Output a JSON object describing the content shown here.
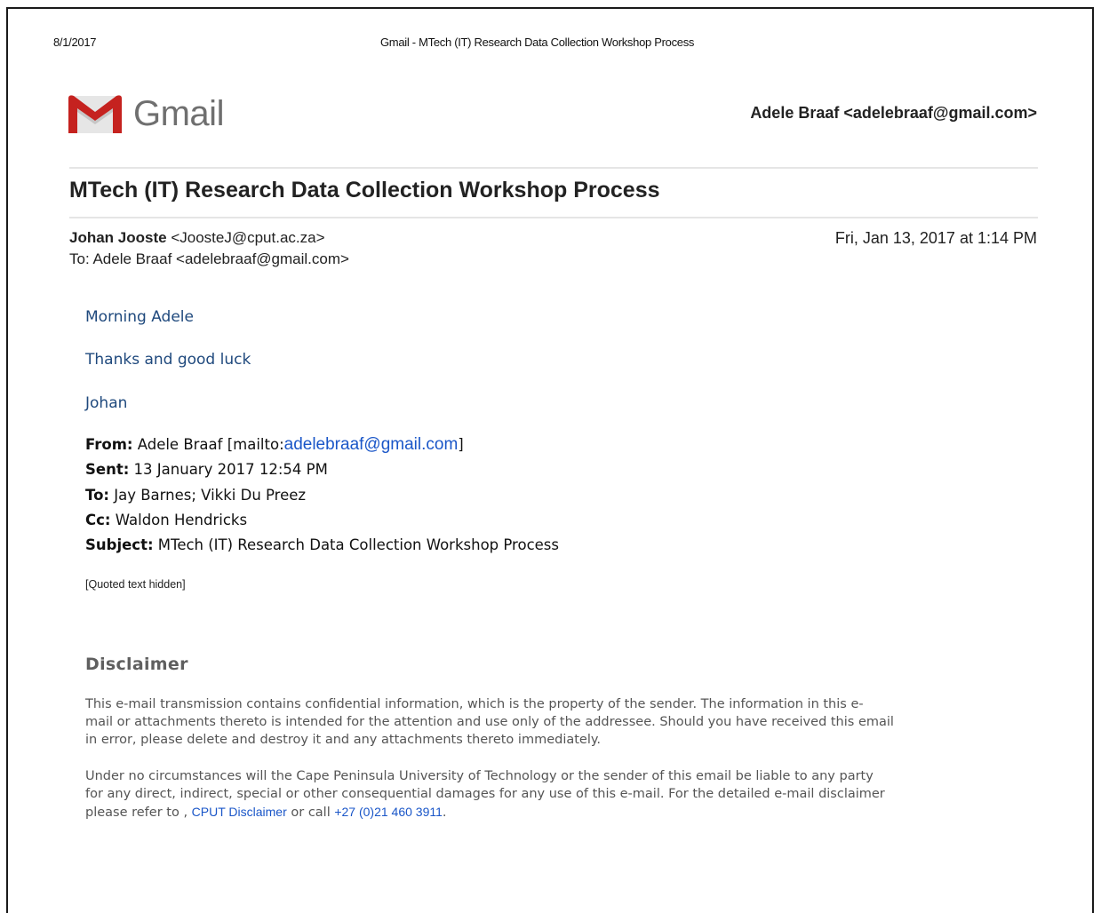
{
  "print_header": {
    "date": "8/1/2017",
    "title": "Gmail - MTech (IT) Research Data Collection Workshop Process"
  },
  "brand": {
    "name": "Gmail",
    "logo_icon": "gmail-m-icon",
    "logo_colors": {
      "red": "#c5221f",
      "bright_red": "#ea4335",
      "inner": "#e6e6e6",
      "shadow": "#b0b0b0"
    }
  },
  "account": "Adele Braaf <adelebraaf@gmail.com>",
  "thread": {
    "subject": "MTech (IT) Research Data Collection Workshop Process"
  },
  "message": {
    "sender_name": "Johan Jooste",
    "sender_email": "<JoosteJ@cput.ac.za>",
    "to_line": "To: Adele Braaf <adelebraaf@gmail.com>",
    "date": "Fri, Jan 13, 2017 at 1:14 PM",
    "body_lines": [
      "Morning Adele",
      "Thanks and good luck",
      "Johan"
    ],
    "forward_header": {
      "from_label": "From:",
      "from_value": " Adele Braaf [mailto:",
      "from_email": "adelebraaf@gmail.com",
      "from_close": "]",
      "sent_label": "Sent:",
      "sent_value": " 13 January 2017 12:54 PM",
      "to_label": "To:",
      "to_value": " Jay Barnes; Vikki Du Preez",
      "cc_label": "Cc:",
      "cc_value": " Waldon Hendricks",
      "subject_label": "Subject:",
      "subject_value": " MTech (IT) Research Data Collection Workshop Process"
    },
    "quoted_text": "[Quoted text hidden]"
  },
  "disclaimer": {
    "title": "Disclaimer",
    "p1_line1": "This e-mail transmission contains confidential information, which is the property of the sender. The information in this e-",
    "p1_line2": "mail or attachments thereto is intended for the attention and use only of the addressee. Should you have received this email",
    "p1_line3": "in error, please delete and destroy it and any attachments thereto immediately.",
    "p2_line1": "Under no circumstances will the Cape Peninsula University of Technology or the sender of this email be liable to any party",
    "p2_line2": "for any direct, indirect, special or other consequential damages for any use of this e-mail. For the detailed e-mail disclaimer",
    "p2_prefix": "please refer to , ",
    "p2_link": "CPUT Disclaimer",
    "p2_mid": " or call ",
    "p2_phone": "+27 (0)21 460 3911",
    "p2_end": "."
  },
  "colors": {
    "body_blue": "#1f497d",
    "link_blue": "#1a56c8",
    "disclaimer_gray": "#555555"
  }
}
